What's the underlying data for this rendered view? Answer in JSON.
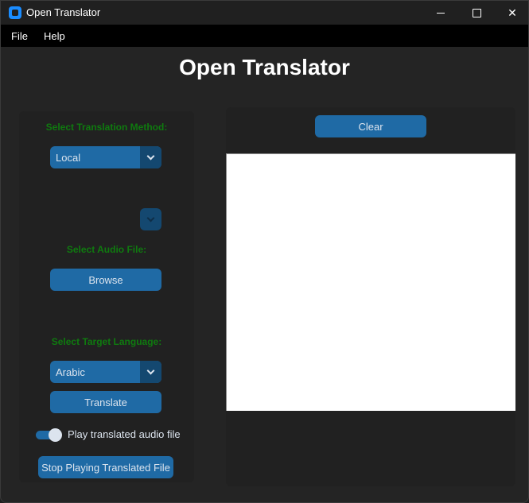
{
  "window": {
    "title": "Open Translator",
    "controls": {
      "minimize_icon": "minimize-icon",
      "maximize_icon": "maximize-icon",
      "close_icon": "close-icon",
      "close_glyph": "✕"
    }
  },
  "menu": {
    "items": [
      {
        "label": "File"
      },
      {
        "label": "Help"
      }
    ]
  },
  "header": {
    "title": "Open Translator"
  },
  "left_panel": {
    "method_label": "Select Translation Method:",
    "method_value": "Local",
    "secondary_dropdown_value": "",
    "audio_label": "Select Audio File:",
    "browse_label": "Browse",
    "language_label": "Select Target Language:",
    "language_value": "Arabic",
    "translate_label": "Translate",
    "play_toggle_label": "Play translated audio file",
    "play_toggle_on": true,
    "stop_label": "Stop Playing Translated File"
  },
  "right_panel": {
    "clear_label": "Clear",
    "output_text": ""
  },
  "colors": {
    "accent": "#1f6aa5",
    "accent_dark": "#144870",
    "label_green": "#0f7a0f",
    "background": "#242424",
    "panel": "#212121"
  }
}
